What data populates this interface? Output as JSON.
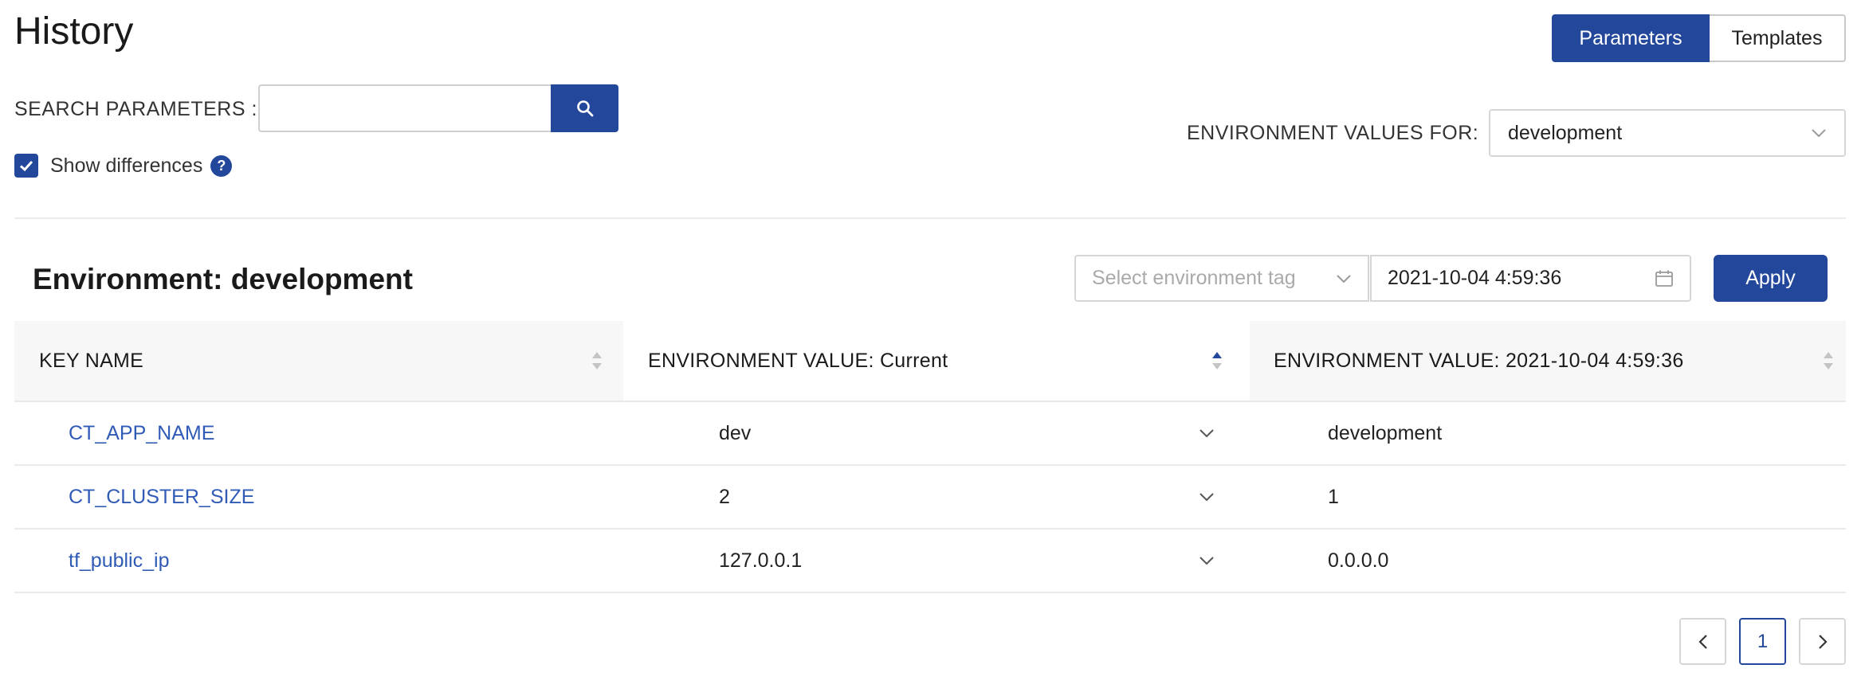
{
  "header": {
    "title": "History",
    "view_toggle": [
      {
        "label": "Parameters",
        "active": true
      },
      {
        "label": "Templates",
        "active": false
      }
    ]
  },
  "search": {
    "label": "SEARCH PARAMETERS :",
    "value": "",
    "placeholder": ""
  },
  "show_differences": {
    "label": "Show differences",
    "checked": true,
    "help": "?"
  },
  "environment_filter": {
    "label": "ENVIRONMENT VALUES FOR:",
    "selected": "development"
  },
  "section": {
    "title": "Environment: development",
    "tag_placeholder": "Select environment tag",
    "date_value": "2021-10-04 4:59:36",
    "apply_label": "Apply"
  },
  "table": {
    "columns": [
      {
        "label": "KEY NAME",
        "sort": "none"
      },
      {
        "label": "ENVIRONMENT VALUE: Current",
        "sort": "ascending"
      },
      {
        "label": "ENVIRONMENT VALUE: 2021-10-04 4:59:36",
        "sort": "none"
      }
    ],
    "rows": [
      {
        "key": "CT_APP_NAME",
        "current": "dev",
        "historical": "development"
      },
      {
        "key": "CT_CLUSTER_SIZE",
        "current": "2",
        "historical": "1"
      },
      {
        "key": "tf_public_ip",
        "current": "127.0.0.1",
        "historical": "0.0.0.0"
      }
    ]
  },
  "pagination": {
    "current_page": "1"
  },
  "colors": {
    "primary": "#23489b",
    "link": "#2f5bb7",
    "header_bg": "#f7f7f7"
  }
}
